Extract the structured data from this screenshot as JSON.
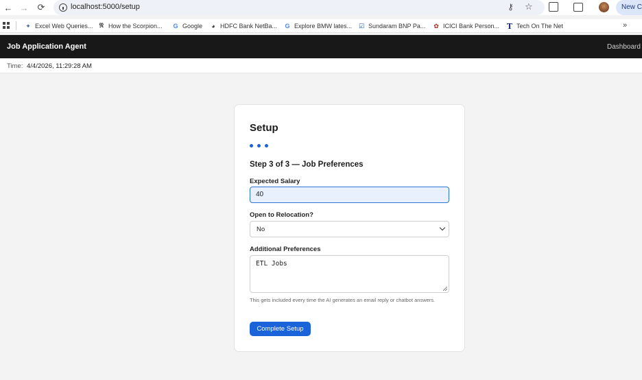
{
  "browser": {
    "url": "localhost:5000/setup",
    "new_chrome_label": "New Ch"
  },
  "bookmarks": [
    {
      "icon": "excel-icon",
      "label": "Excel Web Queries..."
    },
    {
      "icon": "nyt-icon",
      "label": "How the Scorpion..."
    },
    {
      "icon": "google-icon",
      "label": "Google"
    },
    {
      "icon": "globe-icon",
      "label": "HDFC Bank NetBa..."
    },
    {
      "icon": "google-icon",
      "label": "Explore BMW lates..."
    },
    {
      "icon": "sundaram-icon",
      "label": "Sundaram BNP Pa..."
    },
    {
      "icon": "icici-icon",
      "label": "ICICI Bank Person..."
    },
    {
      "icon": "tech-icon",
      "label": "Tech On The Net"
    }
  ],
  "app": {
    "title": "Job Application Agent",
    "nav_dashboard": "Dashboard"
  },
  "timebar": {
    "label": "Time:",
    "value": "4/4/2026, 11:29:28 AM"
  },
  "setup": {
    "title": "Setup",
    "step_title": "Step 3 of 3 — Job Preferences",
    "salary_label": "Expected Salary",
    "salary_value": "40",
    "relocation_label": "Open to Relocation?",
    "relocation_value": "No",
    "preferences_label": "Additional Preferences",
    "preferences_value": "ETL Jobs",
    "help_text": "This gets included every time the AI generates an email reply or chatbot answers.",
    "complete_button": "Complete Setup"
  },
  "colors": {
    "accent": "#1a63d8",
    "appbar": "#181818"
  }
}
